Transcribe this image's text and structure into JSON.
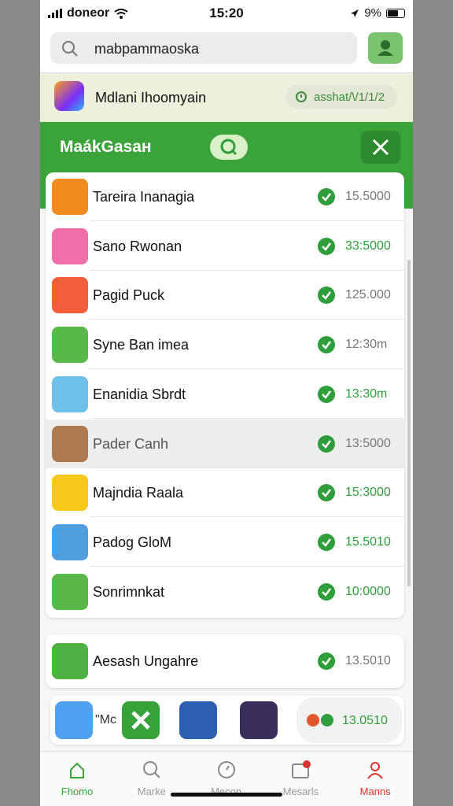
{
  "status_bar": {
    "carrier": "doneor",
    "time": "15:20",
    "battery": "9%"
  },
  "search": {
    "value": "mabpammaoska"
  },
  "banner": {
    "title": "Mdlani Ihoomyain",
    "chip_text": "asshat/\\/1/1/2"
  },
  "header": {
    "title": "MaákGasaн"
  },
  "list": [
    {
      "name": "Tareira Inanagia",
      "value": "15.5000",
      "green": false,
      "color": "#f28a1e",
      "highlight": false
    },
    {
      "name": "Sano Rwonan",
      "value": "33:5000",
      "green": true,
      "color": "#f06fa8",
      "highlight": false
    },
    {
      "name": "Pagid Puck",
      "value": "125.000",
      "green": false,
      "color": "#f25e3a",
      "highlight": false
    },
    {
      "name": "Syne Ban imea",
      "value": "12:30m",
      "green": false,
      "color": "#58b84a",
      "highlight": false
    },
    {
      "name": "Enanidia Sbrdt",
      "value": "13:30m",
      "green": true,
      "color": "#6ec0e8",
      "highlight": false
    },
    {
      "name": "Pader Canh",
      "value": "13:5000",
      "green": false,
      "color": "#b07a50",
      "highlight": true
    },
    {
      "name": "Majndia Raala",
      "value": "15:3000",
      "green": true,
      "color": "#f7c81a",
      "highlight": false
    },
    {
      "name": "Padog GloM",
      "value": "15.5010",
      "green": true,
      "color": "#4f9fe0",
      "highlight": false
    },
    {
      "name": "Sonrimnkat",
      "value": "10:0000",
      "green": true,
      "color": "#5ab84a",
      "highlight": false
    }
  ],
  "featured": {
    "name": "Aesash Ungahre",
    "value": "13.5010",
    "green": false,
    "color": "#4fb043"
  },
  "apps_strip": {
    "label": "\"Mc",
    "value": "13.0510"
  },
  "tabs": [
    {
      "label": "Fhomo",
      "state": "active"
    },
    {
      "label": "Marke",
      "state": "normal"
    },
    {
      "label": "Mecon",
      "state": "normal"
    },
    {
      "label": "Mesarls",
      "state": "normal"
    },
    {
      "label": "Manns",
      "state": "alert"
    }
  ],
  "colors": {
    "accent": "#3aa33a",
    "check": "#2e9e3a",
    "alert": "#d9342b"
  }
}
